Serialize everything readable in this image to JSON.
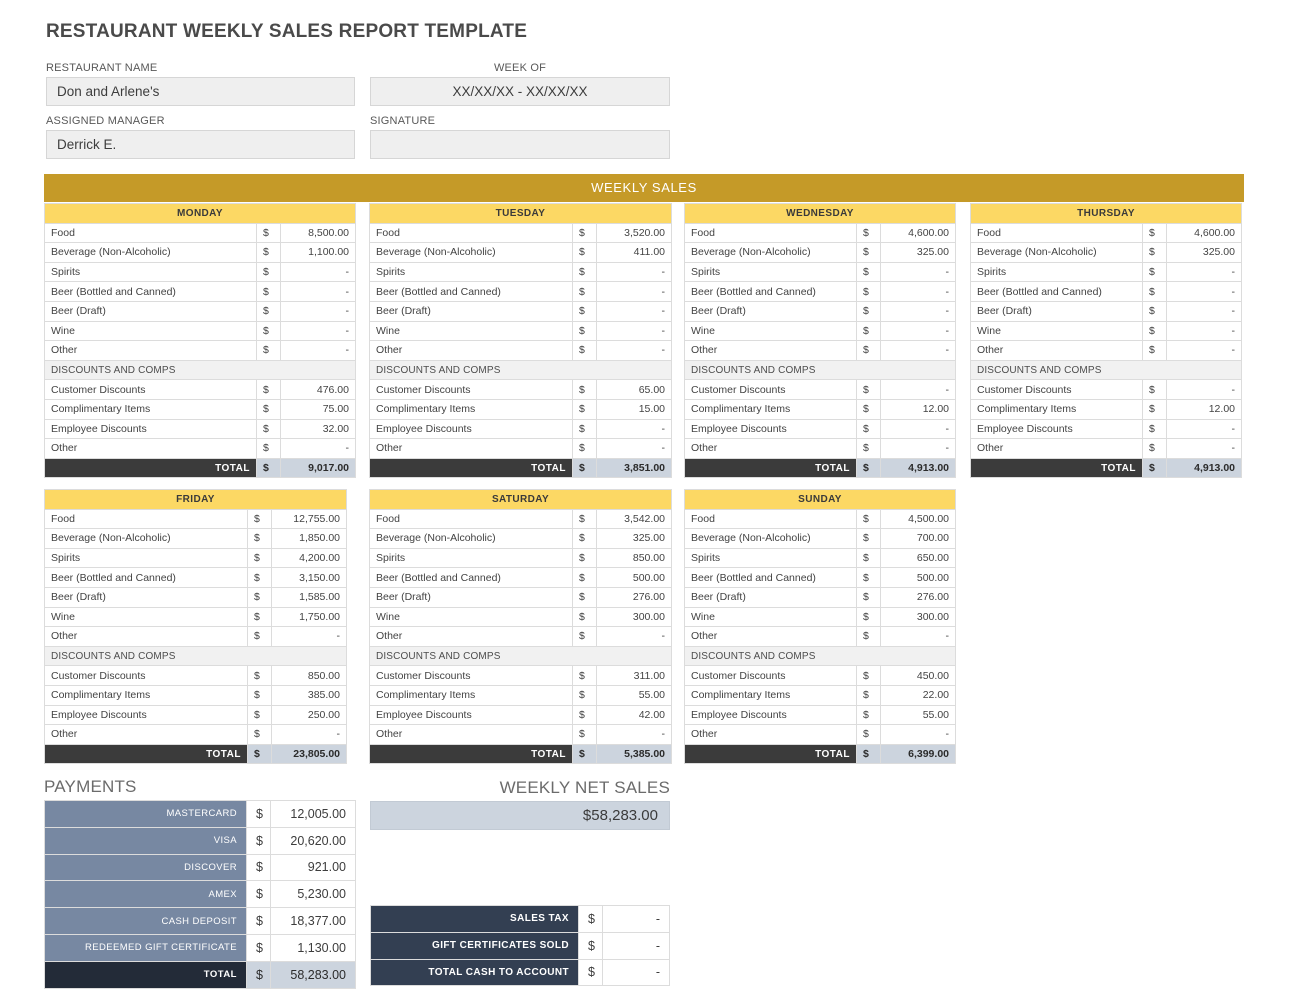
{
  "document": {
    "title": "RESTAURANT WEEKLY SALES REPORT TEMPLATE",
    "colors": {
      "banner_gold": "#c59a28",
      "day_header_yellow": "#fcd864",
      "total_dark": "#3b3b3b",
      "total_fill": "#ccd4de",
      "payment_label_blue": "#7788a2",
      "payment_total_navy": "#232b38",
      "summary_label_navy": "#333f52"
    }
  },
  "header": {
    "restaurant_name_label": "RESTAURANT NAME",
    "restaurant_name_value": "Don and Arlene's",
    "week_of_label": "WEEK OF",
    "week_of_value": "XX/XX/XX - XX/XX/XX",
    "assigned_manager_label": "ASSIGNED MANAGER",
    "assigned_manager_value": "Derrick E.",
    "signature_label": "SIGNATURE",
    "signature_value": ""
  },
  "weekly_sales": {
    "banner_label": "WEEKLY SALES",
    "row_labels": [
      "Food",
      "Beverage (Non-Alcoholic)",
      "Spirits",
      "Beer (Bottled and Canned)",
      "Beer (Draft)",
      "Wine",
      "Other"
    ],
    "discounts_section_label": "DISCOUNTS AND COMPS",
    "discount_labels": [
      "Customer Discounts",
      "Complimentary Items",
      "Employee Discounts",
      "Other"
    ],
    "total_label": "TOTAL",
    "currency_symbol": "$",
    "days": [
      {
        "name": "MONDAY",
        "sales": [
          "8,500.00",
          "1,100.00",
          "-",
          "-",
          "-",
          "-",
          "-"
        ],
        "discounts": [
          "476.00",
          "75.00",
          "32.00",
          "-"
        ],
        "total": "9,017.00"
      },
      {
        "name": "TUESDAY",
        "sales": [
          "3,520.00",
          "411.00",
          "-",
          "-",
          "-",
          "-",
          "-"
        ],
        "discounts": [
          "65.00",
          "15.00",
          "-",
          "-"
        ],
        "total": "3,851.00"
      },
      {
        "name": "WEDNESDAY",
        "sales": [
          "4,600.00",
          "325.00",
          "-",
          "-",
          "-",
          "-",
          "-"
        ],
        "discounts": [
          "-",
          "12.00",
          "-",
          "-"
        ],
        "total": "4,913.00"
      },
      {
        "name": "THURSDAY",
        "sales": [
          "4,600.00",
          "325.00",
          "-",
          "-",
          "-",
          "-",
          "-"
        ],
        "discounts": [
          "-",
          "12.00",
          "-",
          "-"
        ],
        "total": "4,913.00"
      },
      {
        "name": "FRIDAY",
        "sales": [
          "12,755.00",
          "1,850.00",
          "4,200.00",
          "3,150.00",
          "1,585.00",
          "1,750.00",
          "-"
        ],
        "discounts": [
          "850.00",
          "385.00",
          "250.00",
          "-"
        ],
        "total": "23,805.00"
      },
      {
        "name": "SATURDAY",
        "sales": [
          "3,542.00",
          "325.00",
          "850.00",
          "500.00",
          "276.00",
          "300.00",
          "-"
        ],
        "discounts": [
          "311.00",
          "55.00",
          "42.00",
          "-"
        ],
        "total": "5,385.00"
      },
      {
        "name": "SUNDAY",
        "sales": [
          "4,500.00",
          "700.00",
          "650.00",
          "500.00",
          "276.00",
          "300.00",
          "-"
        ],
        "discounts": [
          "450.00",
          "22.00",
          "55.00",
          "-"
        ],
        "total": "6,399.00"
      }
    ]
  },
  "payments": {
    "title": "PAYMENTS",
    "currency_symbol": "$",
    "rows": [
      {
        "label": "MASTERCARD",
        "value": "12,005.00"
      },
      {
        "label": "VISA",
        "value": "20,620.00"
      },
      {
        "label": "DISCOVER",
        "value": "921.00"
      },
      {
        "label": "AMEX",
        "value": "5,230.00"
      },
      {
        "label": "CASH DEPOSIT",
        "value": "18,377.00"
      },
      {
        "label": "REDEEMED GIFT CERTIFICATE",
        "value": "1,130.00"
      }
    ],
    "total_label": "TOTAL",
    "total_value": "58,283.00"
  },
  "weekly_net_sales": {
    "title": "WEEKLY NET SALES",
    "value": "$58,283.00"
  },
  "summary": {
    "currency_symbol": "$",
    "rows": [
      {
        "label": "SALES TAX",
        "value": "-"
      },
      {
        "label": "GIFT CERTIFICATES SOLD",
        "value": "-"
      },
      {
        "label": "TOTAL CASH TO ACCOUNT",
        "value": "-"
      }
    ]
  }
}
